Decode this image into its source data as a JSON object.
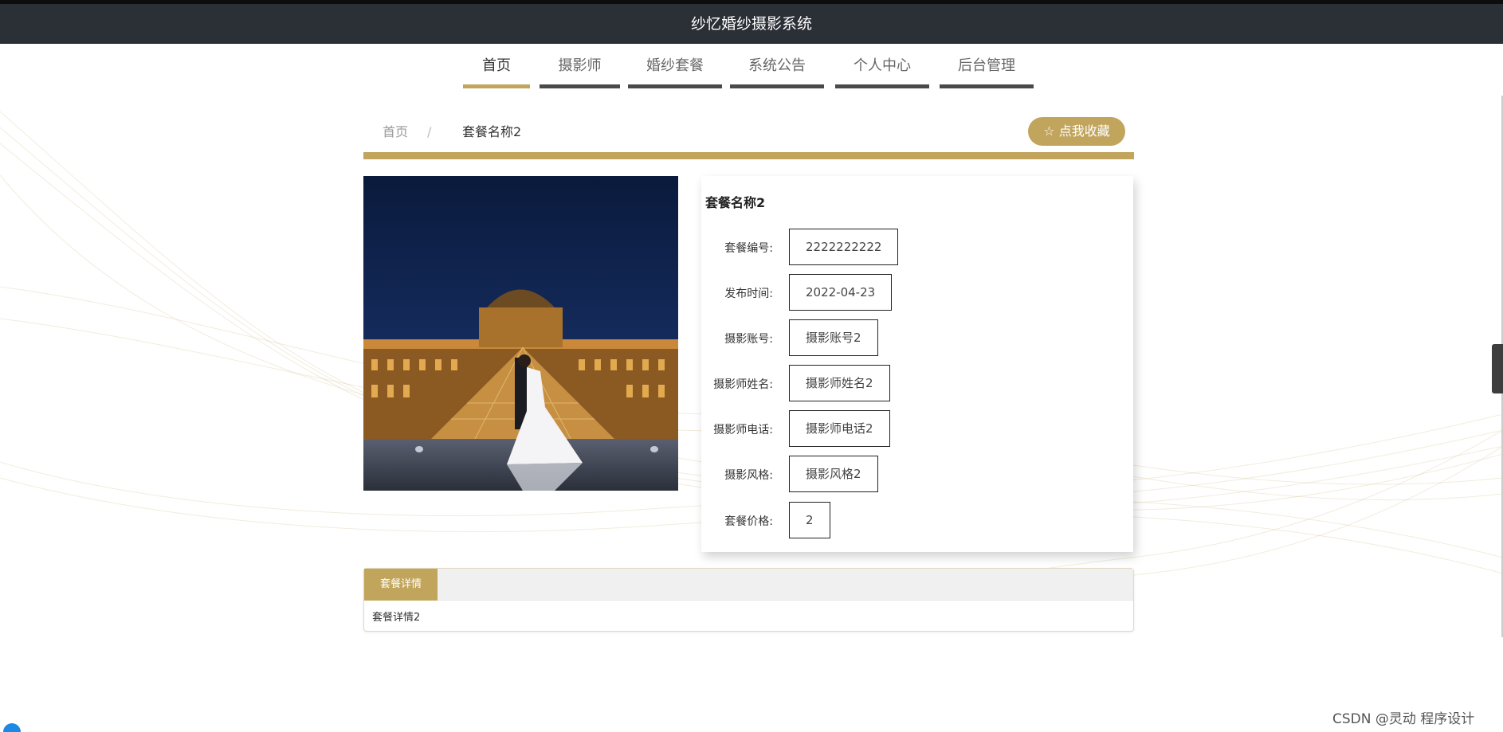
{
  "app": {
    "title": "纱忆婚纱摄影系统"
  },
  "nav": {
    "items": [
      {
        "label": "首页",
        "active": true
      },
      {
        "label": "摄影师",
        "active": false
      },
      {
        "label": "婚纱套餐",
        "active": false
      },
      {
        "label": "系统公告",
        "active": false
      },
      {
        "label": "个人中心",
        "active": false
      },
      {
        "label": "后台管理",
        "active": false
      }
    ]
  },
  "breadcrumb": {
    "home": "首页",
    "separator": "/",
    "current": "套餐名称2"
  },
  "favorite_button": {
    "label": "☆ 点我收藏"
  },
  "package": {
    "title": "套餐名称2",
    "fields": [
      {
        "label": "套餐编号:",
        "value": "2222222222"
      },
      {
        "label": "发布时间:",
        "value": "2022-04-23"
      },
      {
        "label": "摄影账号:",
        "value": "摄影账号2"
      },
      {
        "label": "摄影师姓名:",
        "value": "摄影师姓名2"
      },
      {
        "label": "摄影师电话:",
        "value": "摄影师电话2"
      },
      {
        "label": "摄影风格:",
        "value": "摄影风格2"
      },
      {
        "label": "套餐价格:",
        "value": "2"
      }
    ]
  },
  "detail": {
    "tab_label": "套餐详情",
    "content": "套餐详情2"
  },
  "watermark": "CSDN @灵动 程序设计",
  "colors": {
    "accent": "#c2a55c",
    "header_bg": "#2b2f36"
  }
}
